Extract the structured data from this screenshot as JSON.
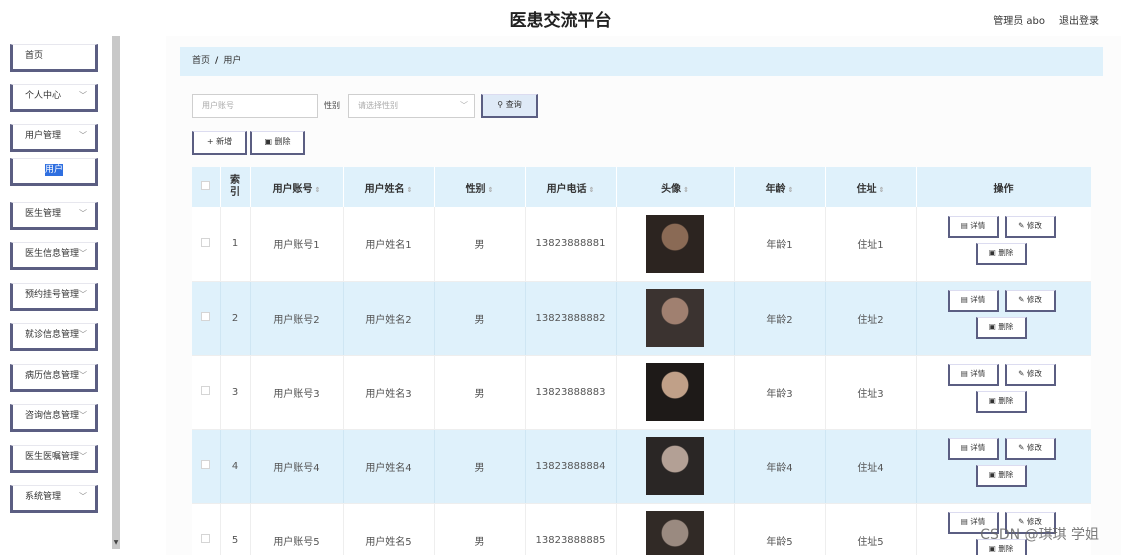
{
  "header": {
    "title": "医患交流平台",
    "user": "管理员 abo",
    "logout": "退出登录"
  },
  "sidebar": {
    "items": [
      {
        "label": "首页",
        "chevron": false
      },
      {
        "label": "个人中心",
        "chevron": true
      },
      {
        "label": "用户管理",
        "chevron": true
      },
      {
        "label": "用户",
        "chevron": false,
        "sub": true
      },
      {
        "label": "医生管理",
        "chevron": true
      },
      {
        "label": "医生信息管理",
        "chevron": true
      },
      {
        "label": "预约挂号管理",
        "chevron": true
      },
      {
        "label": "就诊信息管理",
        "chevron": true
      },
      {
        "label": "病历信息管理",
        "chevron": true
      },
      {
        "label": "咨询信息管理",
        "chevron": true
      },
      {
        "label": "医生医嘱管理",
        "chevron": true
      },
      {
        "label": "系统管理",
        "chevron": true
      }
    ]
  },
  "breadcrumb": {
    "home": "首页",
    "sep": "/",
    "current": "用户"
  },
  "search": {
    "account_placeholder": "用户账号",
    "sex_label": "性别",
    "sex_placeholder": "请选择性别",
    "search_button": "查询"
  },
  "toolbar": {
    "add": "新增",
    "delete": "删除"
  },
  "table": {
    "headers": [
      "",
      "索引",
      "用户账号",
      "用户姓名",
      "性别",
      "用户电话",
      "头像",
      "年龄",
      "住址",
      "操作"
    ],
    "rows": [
      {
        "index": "1",
        "account": "用户账号1",
        "name": "用户姓名1",
        "sex": "男",
        "phone": "13823888881",
        "age": "年龄1",
        "address": "住址1"
      },
      {
        "index": "2",
        "account": "用户账号2",
        "name": "用户姓名2",
        "sex": "男",
        "phone": "13823888882",
        "age": "年龄2",
        "address": "住址2"
      },
      {
        "index": "3",
        "account": "用户账号3",
        "name": "用户姓名3",
        "sex": "男",
        "phone": "13823888883",
        "age": "年龄3",
        "address": "住址3"
      },
      {
        "index": "4",
        "account": "用户账号4",
        "name": "用户姓名4",
        "sex": "男",
        "phone": "13823888884",
        "age": "年龄4",
        "address": "住址4"
      },
      {
        "index": "5",
        "account": "用户账号5",
        "name": "用户姓名5",
        "sex": "男",
        "phone": "13823888885",
        "age": "年龄5",
        "address": "住址5"
      }
    ],
    "ops": {
      "detail": "详情",
      "edit": "修改",
      "delete": "删除"
    }
  },
  "watermark": "CSDN @琪琪 学姐",
  "colors": {
    "accent": "#5b5e82",
    "row_alt": "#dff1fb",
    "highlight": "#2f6fe0"
  }
}
